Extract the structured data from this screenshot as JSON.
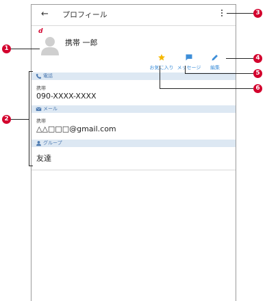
{
  "appbar": {
    "back_icon": "←",
    "title": "プロフィール"
  },
  "logo": {
    "text": "d"
  },
  "contact": {
    "name": "携帯 一郎"
  },
  "actions": [
    {
      "label": "お気に入り",
      "icon": "star-icon",
      "color": "#f5b800"
    },
    {
      "label": "メッセージ",
      "icon": "chat-icon",
      "color": "#3d8ed8"
    },
    {
      "label": "編集",
      "icon": "pencil-icon",
      "color": "#3d8ed8"
    }
  ],
  "sections": {
    "phone": {
      "header": "電話",
      "sub": "携帯",
      "value": "090-XXXX-XXXX"
    },
    "mail": {
      "header": "メール",
      "sub": "携帯",
      "value": "△△□□□@gmail.com"
    },
    "group": {
      "header": "グループ",
      "value": "友達"
    }
  },
  "callouts": [
    "1",
    "2",
    "3",
    "4",
    "5",
    "6"
  ],
  "colors": {
    "accent": "#3d8ed8",
    "section_bg": "#dde8f3",
    "callout": "#d3002d"
  }
}
